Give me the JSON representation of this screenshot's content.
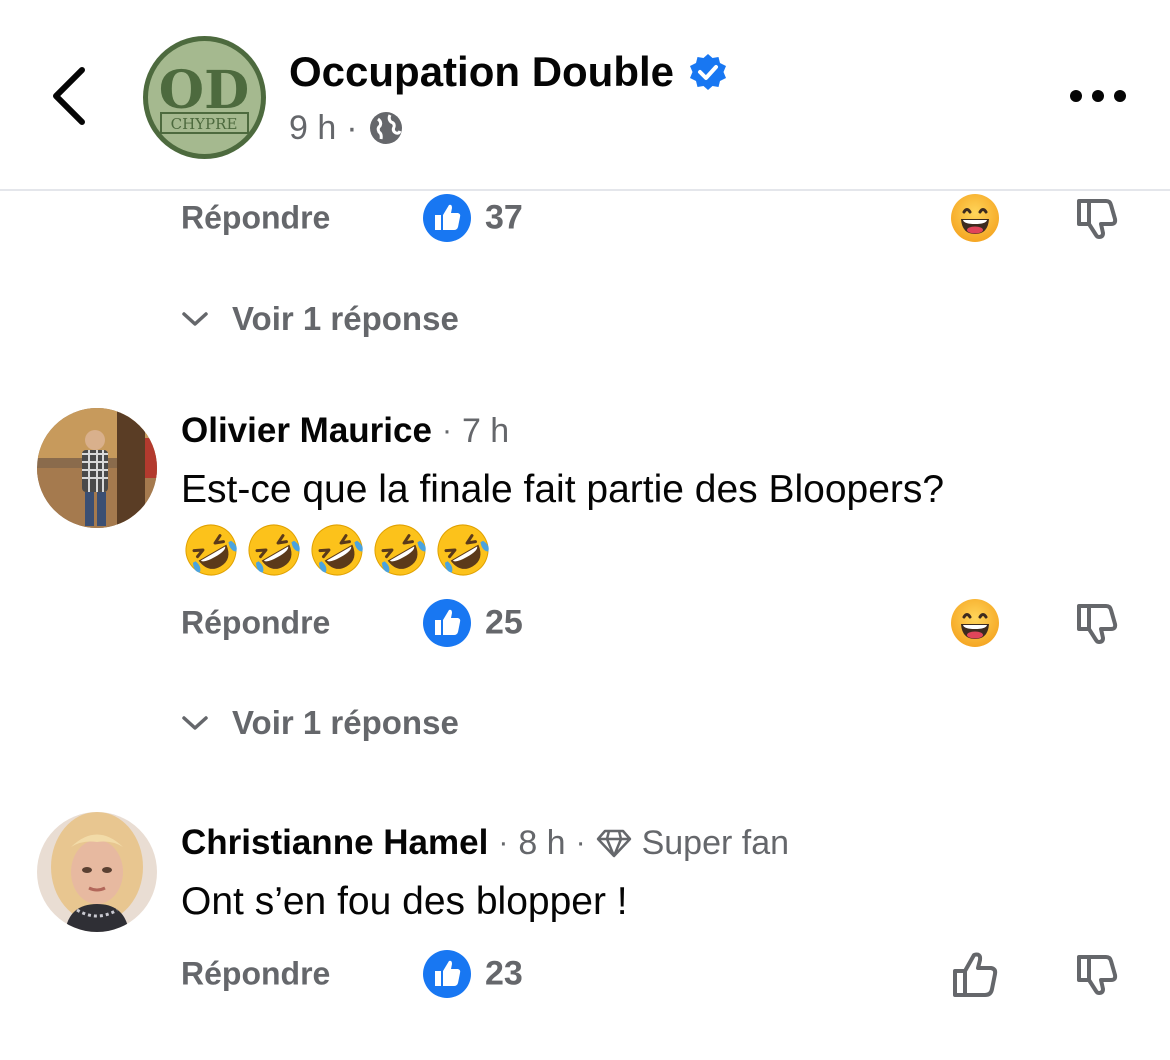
{
  "header": {
    "page_name": "Occupation Double",
    "avatar_initials": "OD",
    "avatar_caption": "CHYPRE",
    "time": "9 h",
    "separator": "·"
  },
  "comments": [
    {
      "reply_label": "Répondre",
      "like_count": "37",
      "see_replies_label": "Voir 1 réponse"
    },
    {
      "author": "Olivier Maurice",
      "time": "7 h",
      "separator": "·",
      "text": "Est-ce que la finale fait partie des Bloopers?",
      "emojis": [
        "rolling-on-floor-laughing",
        "rolling-on-floor-laughing",
        "rolling-on-floor-laughing",
        "rolling-on-floor-laughing",
        "rolling-on-floor-laughing"
      ],
      "reply_label": "Répondre",
      "like_count": "25",
      "see_replies_label": "Voir 1 réponse"
    },
    {
      "author": "Christianne Hamel",
      "time": "8 h",
      "separator": "·",
      "badge": "Super fan",
      "text": "Ont s’en fou des blopper !",
      "reply_label": "Répondre",
      "like_count": "23"
    }
  ],
  "colors": {
    "like_blue": "#1877f2",
    "secondary_text": "#65676b",
    "verified_blue": "#1877f2",
    "avatar_green": "#4d6a3e"
  },
  "icons": {
    "back": "chevron-left-icon",
    "verified": "verified-badge-icon",
    "globe": "globe-icon",
    "more": "more-dots-icon",
    "like": "like-thumb-icon",
    "reaction": "grinning-face-icon",
    "dislike": "thumbs-down-icon",
    "thumbs_up_outline": "thumbs-up-outline-icon",
    "diamond": "diamond-icon",
    "chevron": "chevron-down-icon"
  }
}
